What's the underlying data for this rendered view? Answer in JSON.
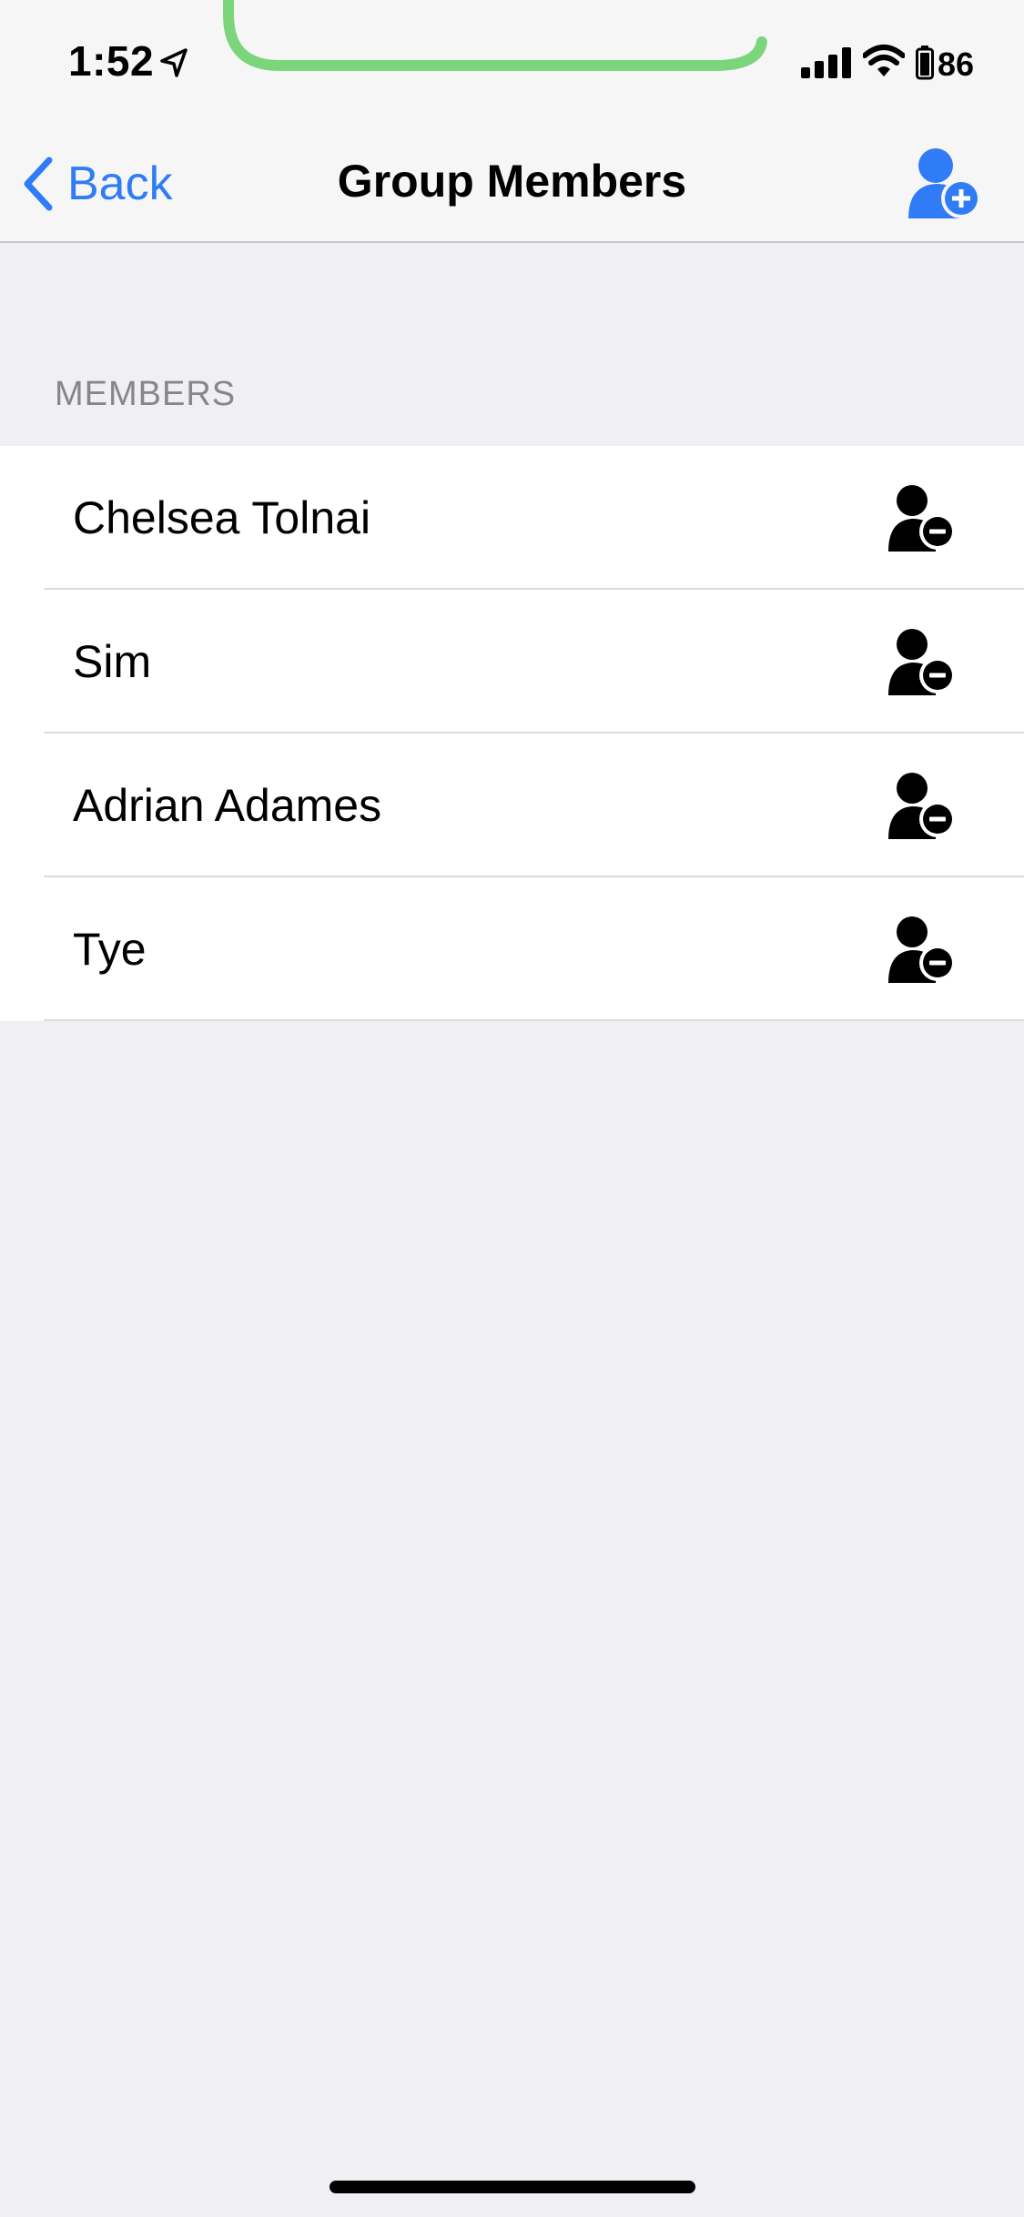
{
  "status_bar": {
    "time": "1:52",
    "battery_level": "86",
    "icons": [
      "location-arrow-icon",
      "signal-bars-icon",
      "wifi-icon",
      "battery-icon"
    ],
    "call_indicator_color": "#7bd57b"
  },
  "nav": {
    "back_label": "Back",
    "title": "Group Members",
    "add_icon": "add-user-icon",
    "accent_color": "#2f7cf6"
  },
  "section": {
    "header": "MEMBERS"
  },
  "members": [
    {
      "name": "Chelsea Tolnai",
      "action_icon": "remove-user-icon"
    },
    {
      "name": "Sim",
      "action_icon": "remove-user-icon"
    },
    {
      "name": "Adrian Adames",
      "action_icon": "remove-user-icon"
    },
    {
      "name": "Tye",
      "action_icon": "remove-user-icon"
    }
  ]
}
